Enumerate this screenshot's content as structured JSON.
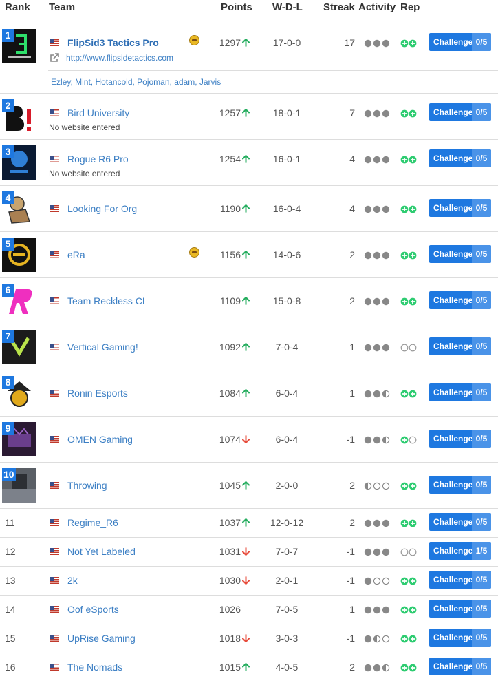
{
  "header": {
    "rank": "Rank",
    "team": "Team",
    "points": "Points",
    "wdl": "W-D-L",
    "streak": "Streak",
    "activity": "Activity",
    "rep": "Rep"
  },
  "challenge_label": "Challenge",
  "colors": {
    "accent": "#1e78e0",
    "up": "#27ae60",
    "down": "#e74c3c",
    "rep": "#2ecc71",
    "activity": "#888888"
  },
  "rows": [
    {
      "rank": "1",
      "name": "FlipSid3 Tactics Pro",
      "website": "http://www.flipsidetactics.com",
      "members": "Ezley, Mint, Hotancold, Pojoman, adam, Jarvis",
      "coin": true,
      "points": "1297",
      "trend": "up",
      "wdl": "17-0-0",
      "streak": "17",
      "activity": [
        "full",
        "full",
        "full"
      ],
      "rep": [
        "plus",
        "plus"
      ],
      "challenges": "0/5",
      "logo": "flipsid3-logo"
    },
    {
      "rank": "2",
      "name": "Bird University",
      "website": "No website entered",
      "points": "1257",
      "trend": "up",
      "wdl": "18-0-1",
      "streak": "7",
      "activity": [
        "full",
        "full",
        "full"
      ],
      "rep": [
        "plus",
        "plus"
      ],
      "challenges": "0/5",
      "logo": "bird-university-logo"
    },
    {
      "rank": "3",
      "name": "Rogue R6 Pro",
      "website": "No website entered",
      "points": "1254",
      "trend": "up",
      "wdl": "16-0-1",
      "streak": "4",
      "activity": [
        "full",
        "full",
        "full"
      ],
      "rep": [
        "plus",
        "plus"
      ],
      "challenges": "0/5",
      "logo": "rogue-logo"
    },
    {
      "rank": "4",
      "name": "Looking For Org",
      "points": "1190",
      "trend": "up",
      "wdl": "16-0-4",
      "streak": "4",
      "activity": [
        "full",
        "full",
        "full"
      ],
      "rep": [
        "plus",
        "plus"
      ],
      "challenges": "0/5",
      "logo": "looking-for-org-logo"
    },
    {
      "rank": "5",
      "name": "eRa",
      "coin": true,
      "points": "1156",
      "trend": "up",
      "wdl": "14-0-6",
      "streak": "2",
      "activity": [
        "full",
        "full",
        "full"
      ],
      "rep": [
        "plus",
        "plus"
      ],
      "challenges": "0/5",
      "logo": "era-logo"
    },
    {
      "rank": "6",
      "name": "Team Reckless CL",
      "points": "1109",
      "trend": "up",
      "wdl": "15-0-8",
      "streak": "2",
      "activity": [
        "full",
        "full",
        "full"
      ],
      "rep": [
        "plus",
        "plus"
      ],
      "challenges": "0/5",
      "logo": "reckless-logo"
    },
    {
      "rank": "7",
      "name": "Vertical Gaming!",
      "points": "1092",
      "trend": "up",
      "wdl": "7-0-4",
      "streak": "1",
      "activity": [
        "full",
        "full",
        "full"
      ],
      "rep": [
        "empty",
        "empty"
      ],
      "challenges": "0/5",
      "logo": "vertical-logo"
    },
    {
      "rank": "8",
      "name": "Ronin Esports",
      "points": "1084",
      "trend": "up",
      "wdl": "6-0-4",
      "streak": "1",
      "activity": [
        "full",
        "full",
        "half"
      ],
      "rep": [
        "plus",
        "plus"
      ],
      "challenges": "0/5",
      "logo": "ronin-logo"
    },
    {
      "rank": "9",
      "name": "OMEN Gaming",
      "points": "1074",
      "trend": "down",
      "wdl": "6-0-4",
      "streak": "-1",
      "activity": [
        "full",
        "full",
        "half"
      ],
      "rep": [
        "plus",
        "empty"
      ],
      "challenges": "0/5",
      "logo": "omen-logo"
    },
    {
      "rank": "10",
      "name": "Throwing",
      "points": "1045",
      "trend": "up",
      "wdl": "2-0-0",
      "streak": "2",
      "activity": [
        "half",
        "empty",
        "empty"
      ],
      "rep": [
        "plus",
        "plus"
      ],
      "challenges": "0/5",
      "logo": "throwing-logo"
    },
    {
      "rank": "11",
      "name": "Regime_R6",
      "points": "1037",
      "trend": "up",
      "wdl": "12-0-12",
      "streak": "2",
      "activity": [
        "full",
        "full",
        "full"
      ],
      "rep": [
        "plus",
        "plus"
      ],
      "challenges": "0/5"
    },
    {
      "rank": "12",
      "name": "Not Yet Labeled",
      "points": "1031",
      "trend": "down",
      "wdl": "7-0-7",
      "streak": "-1",
      "activity": [
        "full",
        "full",
        "full"
      ],
      "rep": [
        "empty",
        "empty"
      ],
      "challenges": "1/5"
    },
    {
      "rank": "13",
      "name": "2k",
      "points": "1030",
      "trend": "down",
      "wdl": "2-0-1",
      "streak": "-1",
      "activity": [
        "full",
        "empty",
        "empty"
      ],
      "rep": [
        "plus",
        "plus"
      ],
      "challenges": "0/5"
    },
    {
      "rank": "14",
      "name": "Oof eSports",
      "points": "1026",
      "trend": "none",
      "wdl": "7-0-5",
      "streak": "1",
      "activity": [
        "full",
        "full",
        "full"
      ],
      "rep": [
        "plus",
        "plus"
      ],
      "challenges": "0/5"
    },
    {
      "rank": "15",
      "name": "UpRise Gaming",
      "points": "1018",
      "trend": "down",
      "wdl": "3-0-3",
      "streak": "-1",
      "activity": [
        "full",
        "half",
        "empty"
      ],
      "rep": [
        "plus",
        "plus"
      ],
      "challenges": "0/5"
    },
    {
      "rank": "16",
      "name": "The Nomads",
      "points": "1015",
      "trend": "up",
      "wdl": "4-0-5",
      "streak": "2",
      "activity": [
        "full",
        "full",
        "half"
      ],
      "rep": [
        "plus",
        "plus"
      ],
      "challenges": "0/5"
    }
  ]
}
